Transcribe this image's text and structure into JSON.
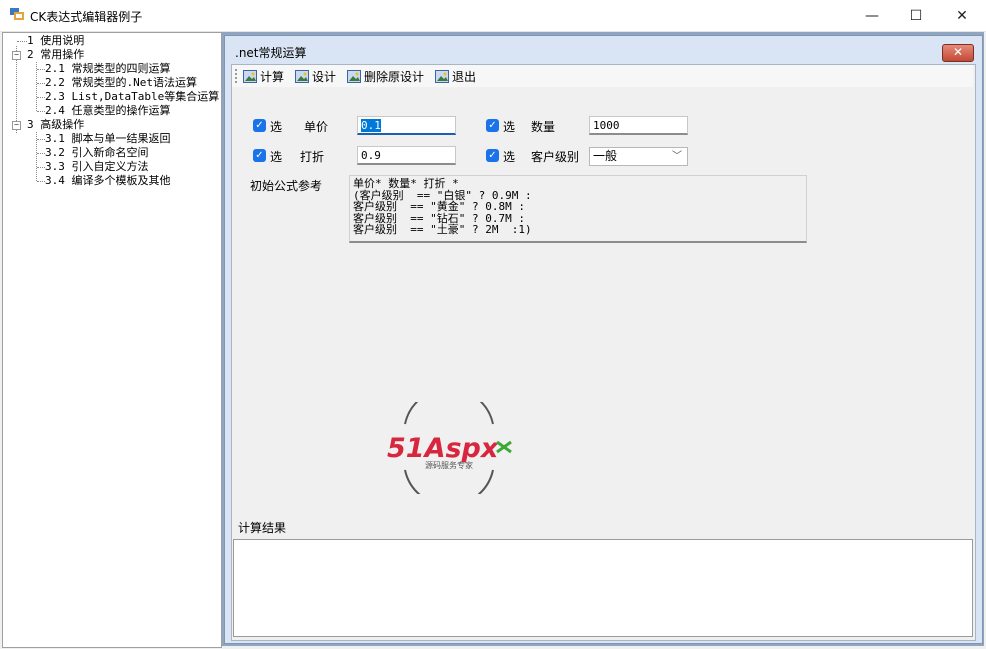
{
  "window": {
    "title": "CK表达式编辑器例子",
    "min_glyph": "—",
    "max_glyph": "☐",
    "close_glyph": "✕"
  },
  "tree": {
    "nodes": [
      {
        "label": "1 使用说明"
      },
      {
        "label": "2 常用操作",
        "expanded": true
      },
      {
        "label": "2.1 常规类型的四则运算"
      },
      {
        "label": "2.2 常规类型的.Net语法运算"
      },
      {
        "label": "2.3 List,DataTable等集合运算"
      },
      {
        "label": "2.4 任意类型的操作运算"
      },
      {
        "label": "3 高级操作",
        "expanded": true
      },
      {
        "label": "3.1 脚本与单一结果返回"
      },
      {
        "label": "3.2 引入新命名空间"
      },
      {
        "label": "3.3 引入自定义方法"
      },
      {
        "label": "3.4 编译多个模板及其他"
      }
    ]
  },
  "child": {
    "title": ".net常规运算",
    "close_glyph": "✕"
  },
  "toolbar": {
    "calc": "计算",
    "design": "设计",
    "delete_design": "删除原设计",
    "exit": "退出"
  },
  "form": {
    "check_label": "选",
    "unit_price": {
      "label": "单价",
      "value": "0.1"
    },
    "quantity": {
      "label": "数量",
      "value": "1000"
    },
    "discount": {
      "label": "打折",
      "value": "0.9"
    },
    "customer_level": {
      "label": "客户级别",
      "value": "一般"
    },
    "formula_label": "初始公式参考",
    "formula_lines": [
      "单价* 数量* 打折 *",
      "(客户级别  == \"白银\" ? 0.9M :",
      "客户级别  == \"黄金\" ? 0.8M :",
      "客户级别  == \"钻石\" ? 0.7M :",
      "客户级别  == \"土豪\" ? 2M  :1)"
    ],
    "result_label": "计算结果"
  },
  "logo": {
    "text": "51Aspx",
    "subtitle": "源码服务专家"
  },
  "colors": {
    "accent": "#1a73e8",
    "mdi_bg": "#8fa5c0",
    "logo_red": "#d7263d",
    "logo_green": "#3aa935"
  }
}
